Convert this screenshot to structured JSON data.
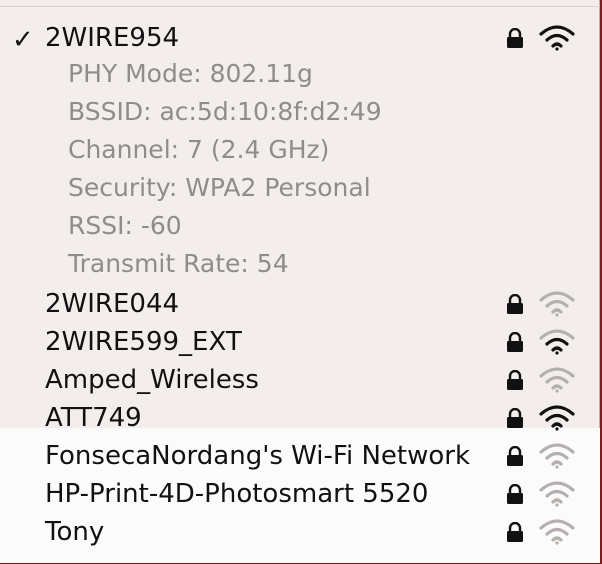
{
  "connected_network": {
    "checkmark": "✓",
    "ssid": "2WIRE954",
    "details": [
      "PHY Mode: 802.11g",
      "BSSID: ac:5d:10:8f:d2:49",
      "Channel: 7 (2.4 GHz)",
      "Security: WPA2 Personal",
      "RSSI: -60",
      "Transmit Rate: 54"
    ],
    "icons": [
      "lock-icon",
      "wifi-signal-icon"
    ]
  },
  "networks": [
    {
      "ssid": "2WIRE044",
      "signal_bars": 1
    },
    {
      "ssid": "2WIRE599_EXT",
      "signal_bars": 2
    },
    {
      "ssid": "Amped_Wireless",
      "signal_bars": 1
    },
    {
      "ssid": "ATT749",
      "signal_bars": 3
    },
    {
      "ssid": "FonsecaNordang's Wi-Fi Network",
      "signal_bars": 1
    },
    {
      "ssid": "HP-Print-4D-Photosmart 5520",
      "signal_bars": 1
    },
    {
      "ssid": "Tony",
      "signal_bars": 1
    }
  ],
  "colors": {
    "menu_background": "#f3eeec",
    "text": "#111111",
    "detail_text": "#8f8c8b",
    "signal_active": "#111111",
    "signal_inactive": "#b5b0ad",
    "desktop_background": "#7a1d1d"
  }
}
